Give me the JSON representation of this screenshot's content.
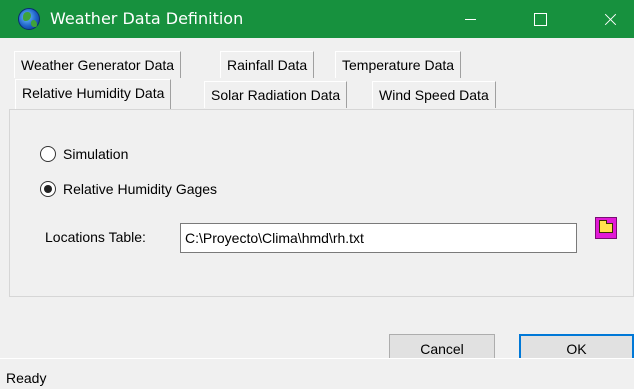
{
  "window": {
    "title": "Weather Data Definition",
    "accent_color": "#17913e",
    "icon": "globe-icon"
  },
  "tabs": {
    "row1": [
      "Weather Generator Data",
      "Rainfall Data",
      "Temperature Data"
    ],
    "row2": [
      "Relative Humidity Data",
      "Solar Radiation Data",
      "Wind Speed Data"
    ],
    "active": "Relative Humidity Data"
  },
  "options": {
    "simulation_label": "Simulation",
    "gages_label": "Relative Humidity Gages",
    "selected": "Relative Humidity Gages"
  },
  "locations": {
    "label": "Locations Table:",
    "value": "C:\\Proyecto\\Clima\\hmd\\rh.txt",
    "browse_icon": "folder-icon"
  },
  "buttons": {
    "cancel": "Cancel",
    "ok": "OK"
  },
  "status": {
    "text": "Ready"
  }
}
